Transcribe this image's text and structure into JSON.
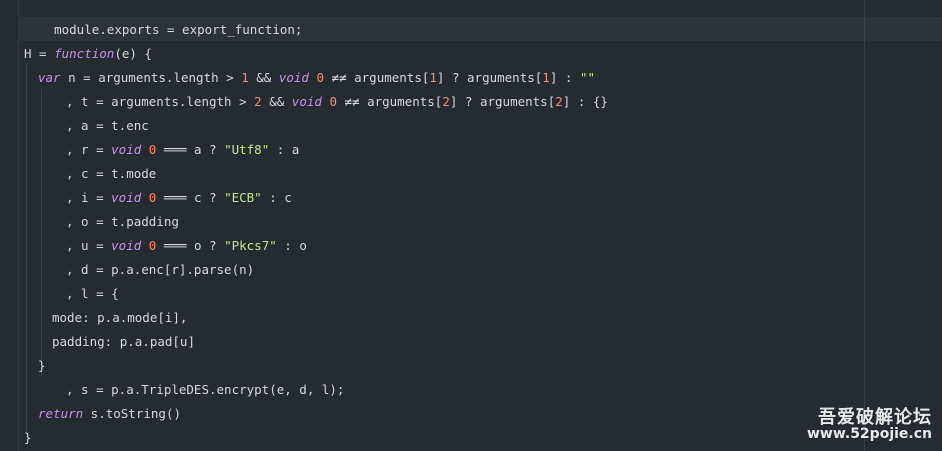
{
  "code": {
    "line_1": {
      "a": "module.exports = export_function;"
    },
    "line_3": {
      "a": "H = ",
      "b": "function",
      "c": "(e) {"
    },
    "line_4": {
      "a": "var",
      "b": " n = arguments.length > ",
      "c": "1",
      "d": " && ",
      "e": "void",
      "f": " ",
      "g": "0",
      "h": " ≠≠ ",
      "i": "arguments[",
      "j": "1",
      "k": "] ? arguments[",
      "l": "1",
      "m": "] : ",
      "n": "\"\""
    },
    "line_5": {
      "a": ", t = arguments.length > ",
      "b": "2",
      "c": " && ",
      "d": "void",
      "e": " ",
      "f": "0",
      "g": " ≠≠ ",
      "h": "arguments[",
      "i": "2",
      "j": "] ? arguments[",
      "k": "2",
      "l": "] : {}"
    },
    "line_6": {
      "a": ", a = t.enc"
    },
    "line_7": {
      "a": ", r = ",
      "b": "void",
      "c": " ",
      "d": "0",
      "e": " ═══ ",
      "f": "a ? ",
      "g": "\"Utf8\"",
      "h": " : a"
    },
    "line_8": {
      "a": ", c = t.mode"
    },
    "line_9": {
      "a": ", i = ",
      "b": "void",
      "c": " ",
      "d": "0",
      "e": " ═══ ",
      "f": "c ? ",
      "g": "\"ECB\"",
      "h": " : c"
    },
    "line_10": {
      "a": ", o = t.padding"
    },
    "line_11": {
      "a": ", u = ",
      "b": "void",
      "c": " ",
      "d": "0",
      "e": " ═══ ",
      "f": "o ? ",
      "g": "\"Pkcs7\"",
      "h": " : o"
    },
    "line_12": {
      "a": ", d = p.a.enc[r].parse(n)"
    },
    "line_13": {
      "a": ", l = {"
    },
    "line_14": {
      "a": "mode: p.a.mode[i],"
    },
    "line_15": {
      "a": "padding: p.a.pad[u]"
    },
    "line_16": {
      "a": "}"
    },
    "line_17": {
      "a": ", s = p.a.TripleDES.encrypt(e, d, l);"
    },
    "line_18": {
      "a": "return",
      "b": " s.toString()"
    },
    "line_19": {
      "a": "}"
    }
  },
  "watermark": {
    "site_name": "吾爱破解论坛",
    "url": "www.52pojie.cn"
  },
  "colors": {
    "background": "#262a31",
    "keyword": "#c792ea",
    "number": "#f78c6c",
    "string": "#c3e88d"
  }
}
